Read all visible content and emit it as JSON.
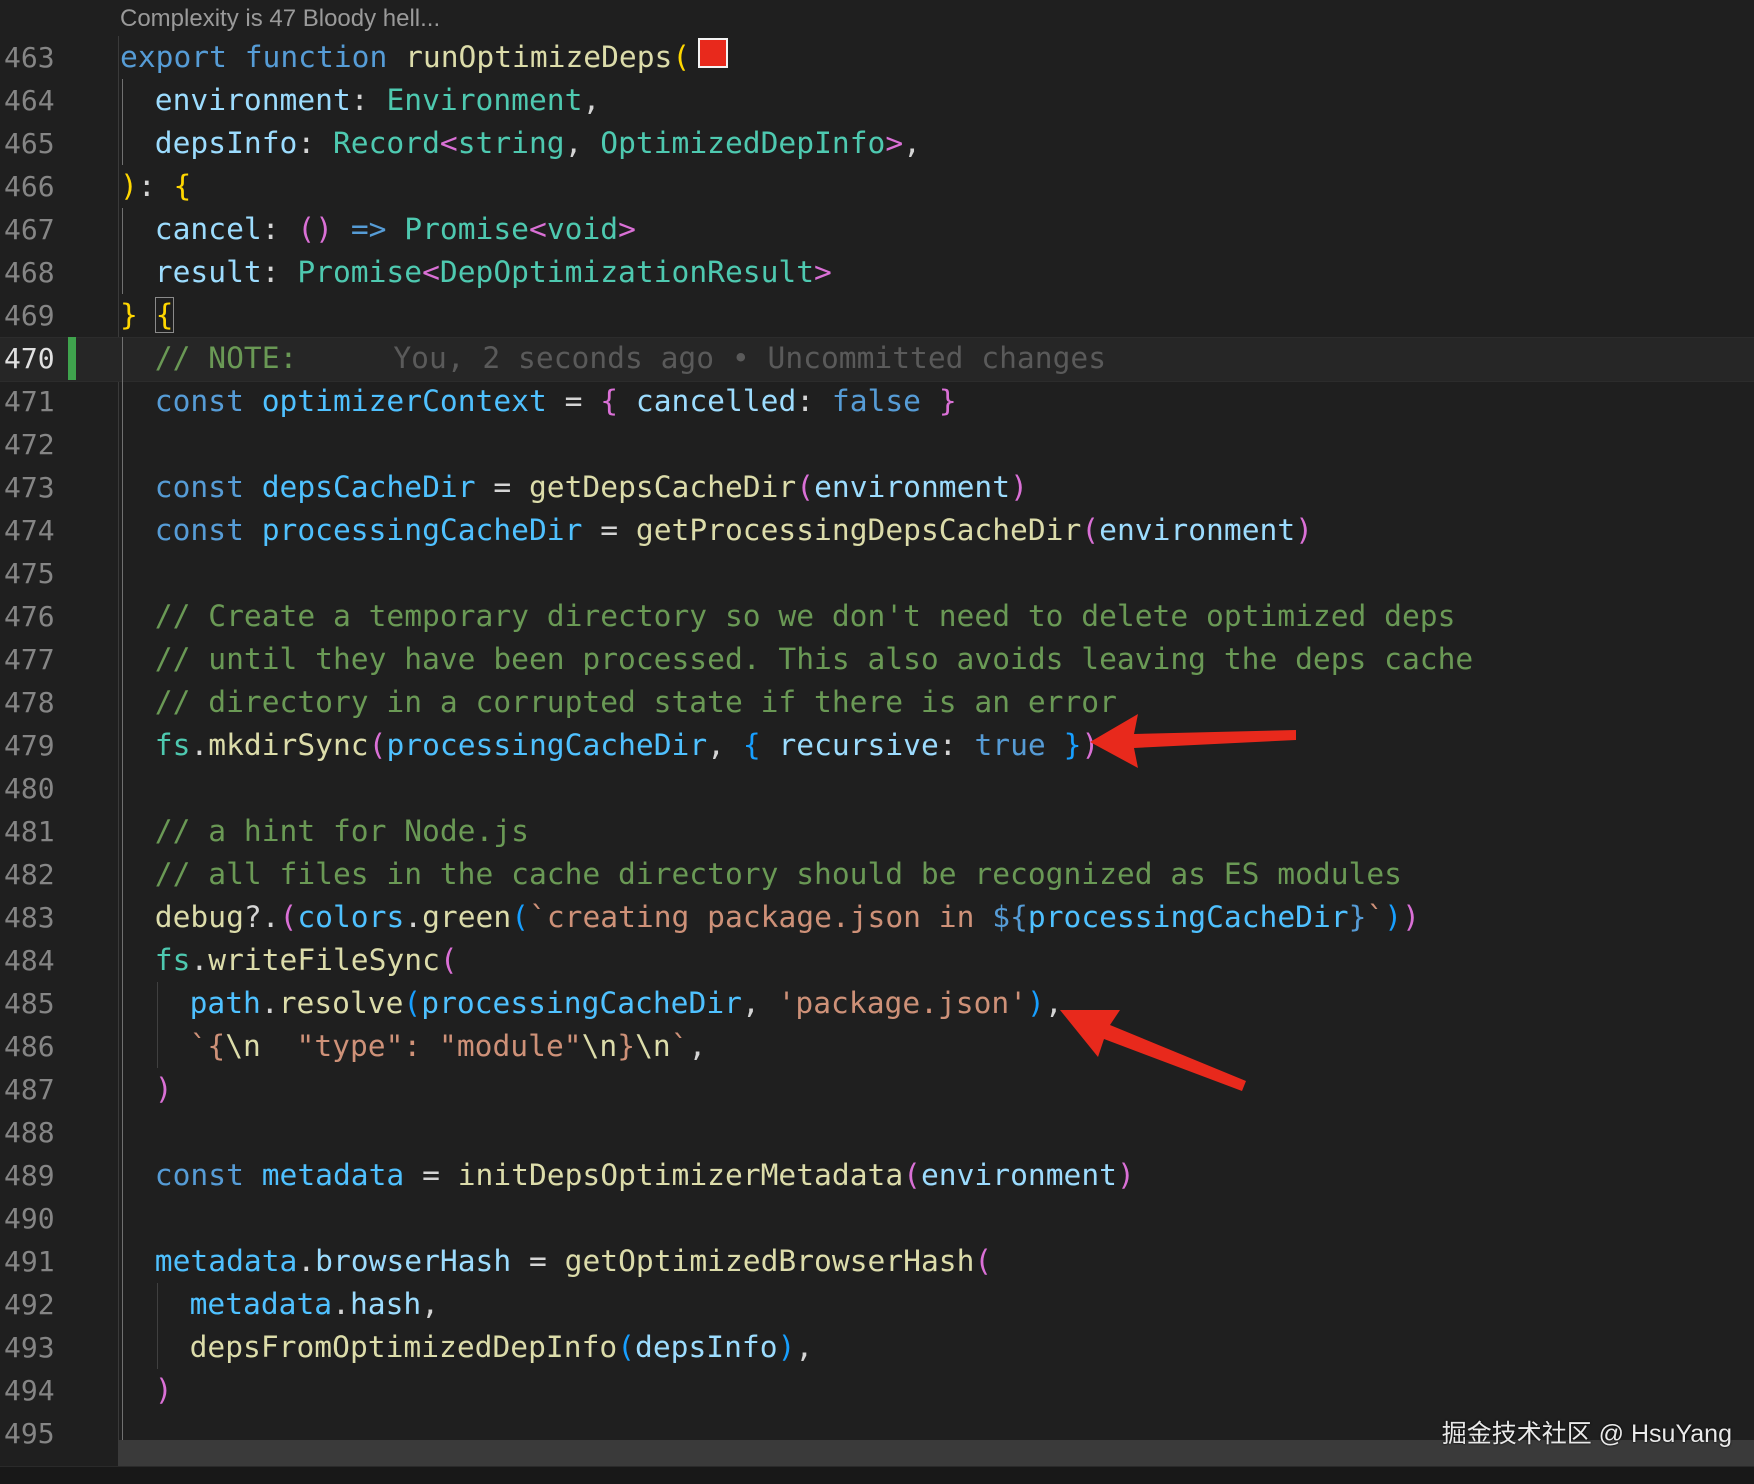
{
  "codelens": "Complexity is 47 Bloody hell...",
  "blame": "You, 2 seconds ago • Uncommitted changes",
  "active_line": 470,
  "watermark": "掘金技术社区 @ HsuYang",
  "colors": {
    "keyword": "#569cd6",
    "function": "#dcdcaa",
    "type": "#4ec9b0",
    "property": "#9cdcfe",
    "variable": "#4fc1ff",
    "comment": "#6a9955",
    "string": "#ce9178",
    "annotation_arrow": "#e8291c",
    "git_added_marker": "#3fa34d"
  },
  "lines": [
    {
      "n": 463,
      "indent": 0,
      "tokens": [
        [
          "kw",
          "export"
        ],
        [
          "pu",
          " "
        ],
        [
          "kw",
          "function"
        ],
        [
          "pu",
          " "
        ],
        [
          "fn",
          "runOptimizeDeps"
        ],
        [
          "br1",
          "("
        ]
      ]
    },
    {
      "n": 464,
      "indent": 1,
      "tokens": [
        [
          "pr",
          "environment"
        ],
        [
          "pu",
          ": "
        ],
        [
          "ty",
          "Environment"
        ],
        [
          "pu",
          ","
        ]
      ]
    },
    {
      "n": 465,
      "indent": 1,
      "tokens": [
        [
          "pr",
          "depsInfo"
        ],
        [
          "pu",
          ": "
        ],
        [
          "ty",
          "Record"
        ],
        [
          "br2",
          "<"
        ],
        [
          "ty",
          "string"
        ],
        [
          "pu",
          ", "
        ],
        [
          "ty",
          "OptimizedDepInfo"
        ],
        [
          "br2",
          ">"
        ],
        [
          "pu",
          ","
        ]
      ]
    },
    {
      "n": 466,
      "indent": 0,
      "tokens": [
        [
          "br1",
          ")"
        ],
        [
          "pu",
          ": "
        ],
        [
          "br1",
          "{"
        ]
      ]
    },
    {
      "n": 467,
      "indent": 1,
      "tokens": [
        [
          "pr",
          "cancel"
        ],
        [
          "pu",
          ": "
        ],
        [
          "br2",
          "()"
        ],
        [
          "pu",
          " "
        ],
        [
          "kw",
          "=>"
        ],
        [
          "pu",
          " "
        ],
        [
          "ty",
          "Promise"
        ],
        [
          "br2",
          "<"
        ],
        [
          "ty",
          "void"
        ],
        [
          "br2",
          ">"
        ]
      ]
    },
    {
      "n": 468,
      "indent": 1,
      "tokens": [
        [
          "pr",
          "result"
        ],
        [
          "pu",
          ": "
        ],
        [
          "ty",
          "Promise"
        ],
        [
          "br2",
          "<"
        ],
        [
          "ty",
          "DepOptimizationResult"
        ],
        [
          "br2",
          ">"
        ]
      ]
    },
    {
      "n": 469,
      "indent": 0,
      "tokens": [
        [
          "br1",
          "}"
        ],
        [
          "pu",
          " "
        ],
        [
          "br1",
          "{"
        ]
      ]
    },
    {
      "n": 470,
      "indent": 1,
      "tokens": [
        [
          "cm",
          "// NOTE:"
        ]
      ]
    },
    {
      "n": 471,
      "indent": 1,
      "tokens": [
        [
          "kw",
          "const"
        ],
        [
          "pu",
          " "
        ],
        [
          "vr",
          "optimizerContext"
        ],
        [
          "pu",
          " = "
        ],
        [
          "br2",
          "{"
        ],
        [
          "pu",
          " "
        ],
        [
          "pr",
          "cancelled"
        ],
        [
          "pu",
          ": "
        ],
        [
          "kw",
          "false"
        ],
        [
          "pu",
          " "
        ],
        [
          "br2",
          "}"
        ]
      ]
    },
    {
      "n": 472,
      "indent": 1,
      "tokens": []
    },
    {
      "n": 473,
      "indent": 1,
      "tokens": [
        [
          "kw",
          "const"
        ],
        [
          "pu",
          " "
        ],
        [
          "vr",
          "depsCacheDir"
        ],
        [
          "pu",
          " = "
        ],
        [
          "fn",
          "getDepsCacheDir"
        ],
        [
          "br2",
          "("
        ],
        [
          "pr",
          "environment"
        ],
        [
          "br2",
          ")"
        ]
      ]
    },
    {
      "n": 474,
      "indent": 1,
      "tokens": [
        [
          "kw",
          "const"
        ],
        [
          "pu",
          " "
        ],
        [
          "vr",
          "processingCacheDir"
        ],
        [
          "pu",
          " = "
        ],
        [
          "fn",
          "getProcessingDepsCacheDir"
        ],
        [
          "br2",
          "("
        ],
        [
          "pr",
          "environment"
        ],
        [
          "br2",
          ")"
        ]
      ]
    },
    {
      "n": 475,
      "indent": 1,
      "tokens": []
    },
    {
      "n": 476,
      "indent": 1,
      "tokens": [
        [
          "cm",
          "// Create a temporary directory so we don't need to delete optimized deps"
        ]
      ]
    },
    {
      "n": 477,
      "indent": 1,
      "tokens": [
        [
          "cm",
          "// until they have been processed. This also avoids leaving the deps cache"
        ]
      ]
    },
    {
      "n": 478,
      "indent": 1,
      "tokens": [
        [
          "cm",
          "// directory in a corrupted state if there is an error"
        ]
      ]
    },
    {
      "n": 479,
      "indent": 1,
      "tokens": [
        [
          "ty",
          "fs"
        ],
        [
          "pu",
          "."
        ],
        [
          "fn",
          "mkdirSync"
        ],
        [
          "br2",
          "("
        ],
        [
          "vr",
          "processingCacheDir"
        ],
        [
          "pu",
          ", "
        ],
        [
          "br3",
          "{"
        ],
        [
          "pu",
          " "
        ],
        [
          "pr",
          "recursive"
        ],
        [
          "pu",
          ": "
        ],
        [
          "kw",
          "true"
        ],
        [
          "pu",
          " "
        ],
        [
          "br3",
          "}"
        ],
        [
          "br2",
          ")"
        ]
      ]
    },
    {
      "n": 480,
      "indent": 1,
      "tokens": []
    },
    {
      "n": 481,
      "indent": 1,
      "tokens": [
        [
          "cm",
          "// a hint for Node.js"
        ]
      ]
    },
    {
      "n": 482,
      "indent": 1,
      "tokens": [
        [
          "cm",
          "// all files in the cache directory should be recognized as ES modules"
        ]
      ]
    },
    {
      "n": 483,
      "indent": 1,
      "tokens": [
        [
          "fn",
          "debug"
        ],
        [
          "pu",
          "?."
        ],
        [
          "br2",
          "("
        ],
        [
          "vr",
          "colors"
        ],
        [
          "pu",
          "."
        ],
        [
          "fn",
          "green"
        ],
        [
          "br3",
          "("
        ],
        [
          "st",
          "`creating package.json in "
        ],
        [
          "kw",
          "${"
        ],
        [
          "vr",
          "processingCacheDir"
        ],
        [
          "kw",
          "}"
        ],
        [
          "st",
          "`"
        ],
        [
          "br3",
          ")"
        ],
        [
          "br2",
          ")"
        ]
      ]
    },
    {
      "n": 484,
      "indent": 1,
      "tokens": [
        [
          "ty",
          "fs"
        ],
        [
          "pu",
          "."
        ],
        [
          "fn",
          "writeFileSync"
        ],
        [
          "br2",
          "("
        ]
      ]
    },
    {
      "n": 485,
      "indent": 2,
      "tokens": [
        [
          "vr",
          "path"
        ],
        [
          "pu",
          "."
        ],
        [
          "fn",
          "resolve"
        ],
        [
          "br3",
          "("
        ],
        [
          "vr",
          "processingCacheDir"
        ],
        [
          "pu",
          ", "
        ],
        [
          "st",
          "'package.json'"
        ],
        [
          "br3",
          ")"
        ],
        [
          "pu",
          ","
        ]
      ]
    },
    {
      "n": 486,
      "indent": 2,
      "tokens": [
        [
          "st",
          "`{"
        ],
        [
          "fn",
          "\\n"
        ],
        [
          "st",
          "  \"type\": \"module\""
        ],
        [
          "fn",
          "\\n"
        ],
        [
          "st",
          "}"
        ],
        [
          "fn",
          "\\n"
        ],
        [
          "st",
          "`"
        ],
        [
          "pu",
          ","
        ]
      ]
    },
    {
      "n": 487,
      "indent": 1,
      "tokens": [
        [
          "br2",
          ")"
        ]
      ]
    },
    {
      "n": 488,
      "indent": 1,
      "tokens": []
    },
    {
      "n": 489,
      "indent": 1,
      "tokens": [
        [
          "kw",
          "const"
        ],
        [
          "pu",
          " "
        ],
        [
          "vr",
          "metadata"
        ],
        [
          "pu",
          " = "
        ],
        [
          "fn",
          "initDepsOptimizerMetadata"
        ],
        [
          "br2",
          "("
        ],
        [
          "pr",
          "environment"
        ],
        [
          "br2",
          ")"
        ]
      ]
    },
    {
      "n": 490,
      "indent": 1,
      "tokens": []
    },
    {
      "n": 491,
      "indent": 1,
      "tokens": [
        [
          "vr",
          "metadata"
        ],
        [
          "pu",
          "."
        ],
        [
          "pr",
          "browserHash"
        ],
        [
          "pu",
          " = "
        ],
        [
          "fn",
          "getOptimizedBrowserHash"
        ],
        [
          "br2",
          "("
        ]
      ]
    },
    {
      "n": 492,
      "indent": 2,
      "tokens": [
        [
          "vr",
          "metadata"
        ],
        [
          "pu",
          "."
        ],
        [
          "pr",
          "hash"
        ],
        [
          "pu",
          ","
        ]
      ]
    },
    {
      "n": 493,
      "indent": 2,
      "tokens": [
        [
          "fn",
          "depsFromOptimizedDepInfo"
        ],
        [
          "br3",
          "("
        ],
        [
          "pr",
          "depsInfo"
        ],
        [
          "br3",
          ")"
        ],
        [
          "pu",
          ","
        ]
      ]
    },
    {
      "n": 494,
      "indent": 1,
      "tokens": [
        [
          "br2",
          ")"
        ]
      ]
    },
    {
      "n": 495,
      "indent": 1,
      "tokens": []
    }
  ]
}
